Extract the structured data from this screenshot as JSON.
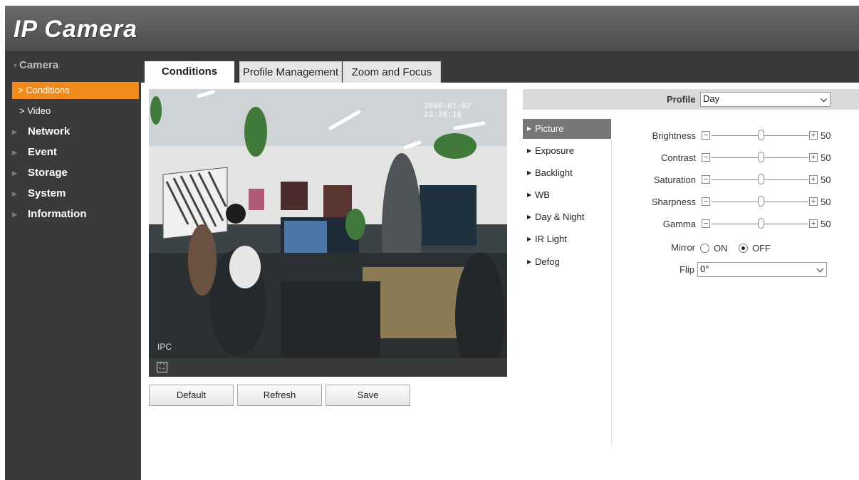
{
  "header": {
    "logo": "IP Camera"
  },
  "sidebar": {
    "camera": {
      "label": "Camera",
      "items": [
        {
          "label": "> Conditions",
          "active": true
        },
        {
          "label": "> Video",
          "active": false
        }
      ]
    },
    "sections": [
      {
        "label": "Network"
      },
      {
        "label": "Event"
      },
      {
        "label": "Storage"
      },
      {
        "label": "System"
      },
      {
        "label": "Information"
      }
    ]
  },
  "tabs": [
    {
      "label": "Conditions",
      "active": true
    },
    {
      "label": "Profile Management",
      "active": false
    },
    {
      "label": "Zoom and Focus",
      "active": false
    }
  ],
  "video": {
    "timestamp": "2000-01-02 23:26:18",
    "channel_label": "IPC"
  },
  "buttons": {
    "default": "Default",
    "refresh": "Refresh",
    "save": "Save"
  },
  "profile": {
    "label": "Profile",
    "value": "Day"
  },
  "menu": [
    {
      "label": "Picture",
      "active": true
    },
    {
      "label": "Exposure",
      "active": false
    },
    {
      "label": "Backlight",
      "active": false
    },
    {
      "label": "WB",
      "active": false
    },
    {
      "label": "Day & Night",
      "active": false
    },
    {
      "label": "IR Light",
      "active": false
    },
    {
      "label": "Defog",
      "active": false
    }
  ],
  "sliders": [
    {
      "label": "Brightness",
      "value": "50"
    },
    {
      "label": "Contrast",
      "value": "50"
    },
    {
      "label": "Saturation",
      "value": "50"
    },
    {
      "label": "Sharpness",
      "value": "50"
    },
    {
      "label": "Gamma",
      "value": "50"
    }
  ],
  "mirror": {
    "label": "Mirror",
    "on_label": "ON",
    "off_label": "OFF",
    "selected": "OFF"
  },
  "flip": {
    "label": "Flip",
    "value": "0°"
  },
  "colors": {
    "accent": "#f28a1b",
    "sidebar": "#3a3a3a",
    "header": "#5a5a5a",
    "menu_active": "#777777"
  }
}
